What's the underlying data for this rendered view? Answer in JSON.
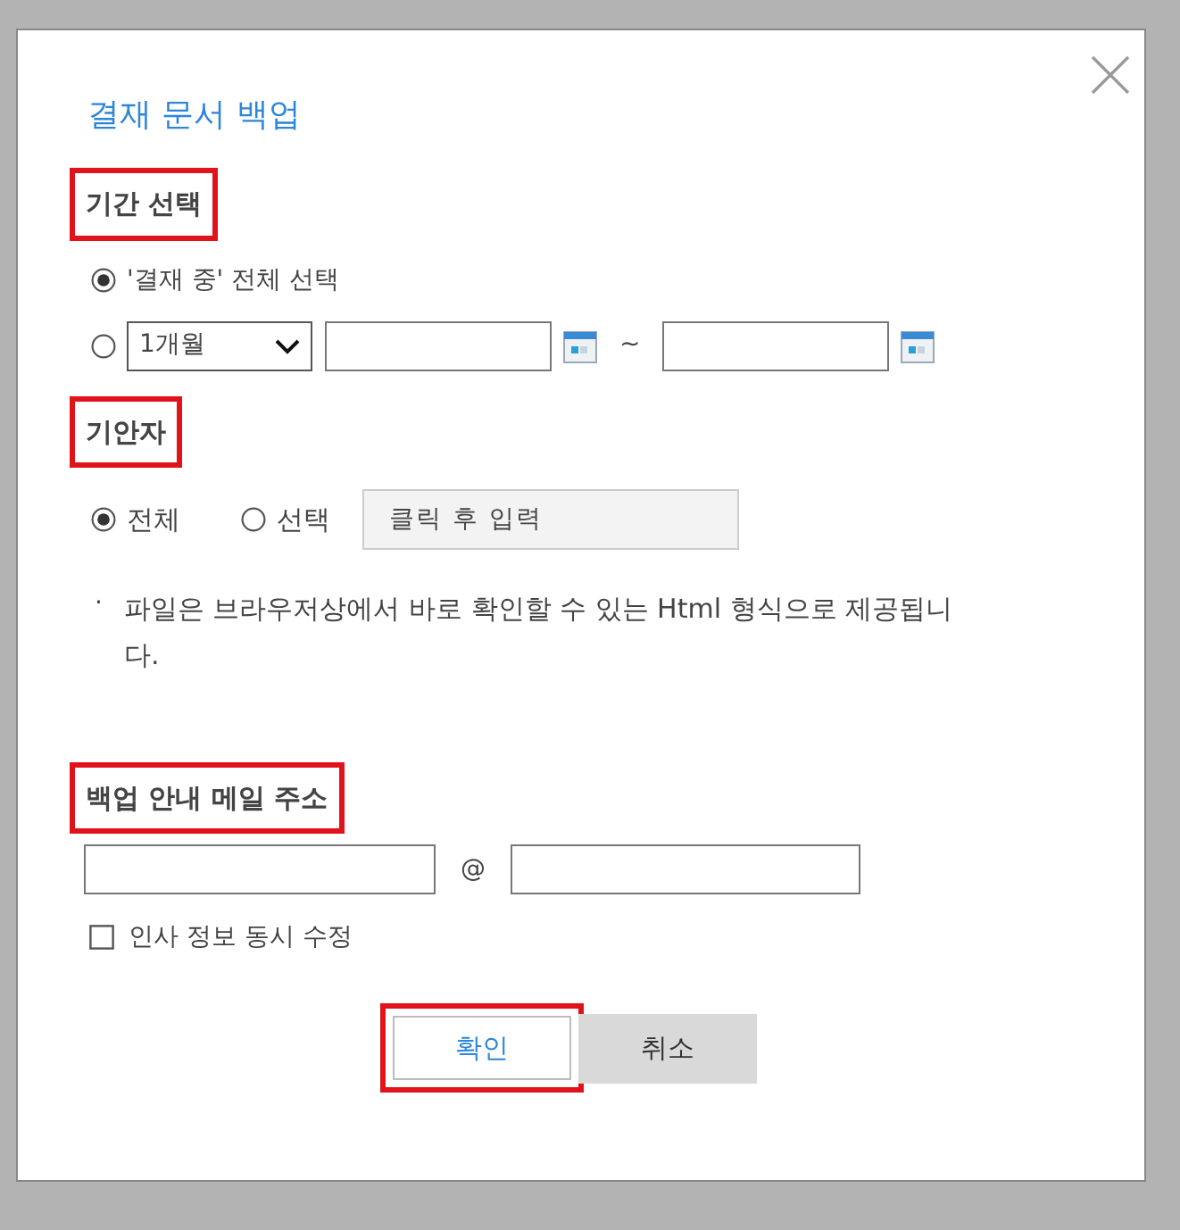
{
  "dialog": {
    "title": "결재 문서 백업",
    "period": {
      "heading": "기간 선택",
      "highlighted": true,
      "options": [
        {
          "kind": "all",
          "label": "'결재 중' 전체 선택",
          "selected": true
        },
        {
          "kind": "range",
          "selected": false,
          "select_value": "1개월",
          "separator": "~"
        }
      ]
    },
    "drafter": {
      "heading": "기안자",
      "highlighted": true,
      "options": [
        {
          "label": "전체",
          "selected": true
        },
        {
          "label": "선택",
          "selected": false
        }
      ],
      "field_placeholder": "클릭 후 입력"
    },
    "note": {
      "bullet": "·",
      "text": "파일은 브라우저상에서 바로 확인할 수 있는 Html 형식으로 제공됩니다."
    },
    "email": {
      "heading": "백업 안내 메일 주소",
      "highlighted": true,
      "at": "@"
    },
    "checkbox": {
      "label": "인사 정보 동시 수정",
      "checked": false
    },
    "buttons": [
      {
        "kind": "primary",
        "label": "확인",
        "highlighted": true
      },
      {
        "kind": "secondary",
        "label": "취소",
        "highlighted": false
      }
    ]
  }
}
